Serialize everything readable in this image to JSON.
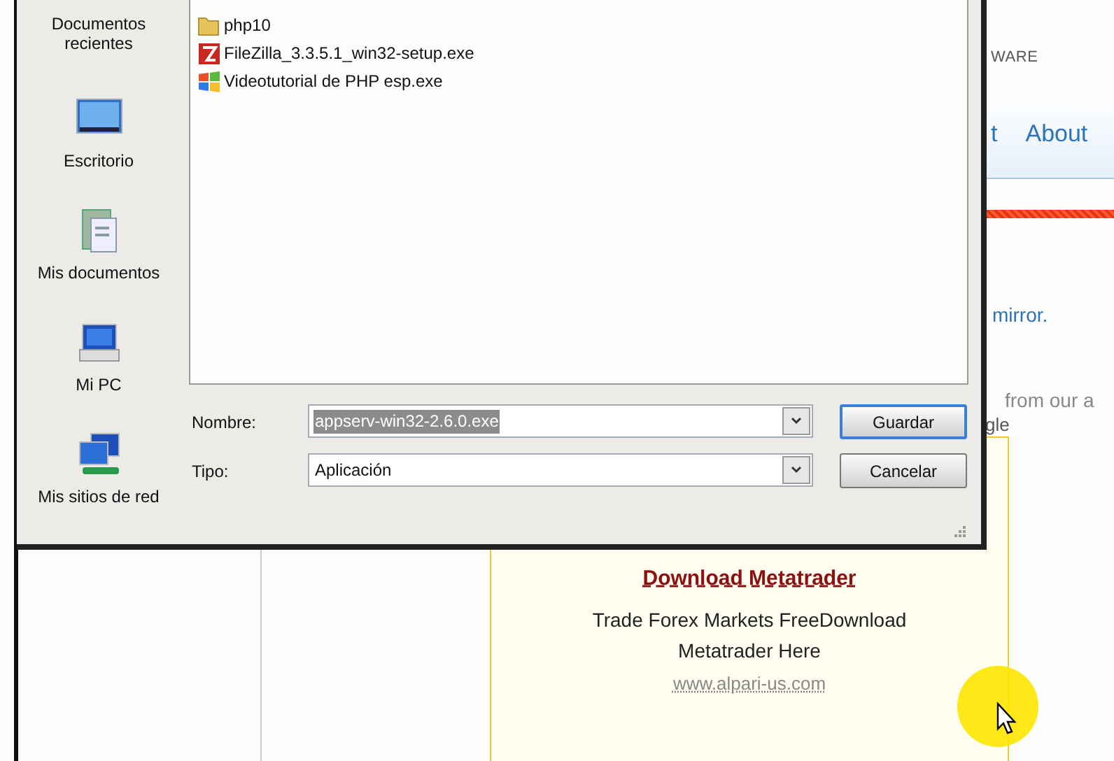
{
  "dialog": {
    "places": [
      {
        "label": "Documentos recientes",
        "kind": "recent"
      },
      {
        "label": "Escritorio",
        "kind": "desktop"
      },
      {
        "label": "Mis documentos",
        "kind": "documents"
      },
      {
        "label": "Mi PC",
        "kind": "computer"
      },
      {
        "label": "Mis sitios de red",
        "kind": "network"
      }
    ],
    "files": [
      {
        "name": "php10",
        "kind": "folder"
      },
      {
        "name": "FileZilla_3.3.5.1_win32-setup.exe",
        "kind": "filezilla"
      },
      {
        "name": "Videotutorial de PHP esp.exe",
        "kind": "installer"
      }
    ],
    "filename_label": "Nombre:",
    "filename_value": "appserv-win32-2.6.0.exe",
    "filename_selected": true,
    "type_label": "Tipo:",
    "type_value": "Aplicación",
    "buttons": [
      {
        "label": "Guardar",
        "default": true
      },
      {
        "label": "Cancelar",
        "default": false
      }
    ]
  },
  "webpage": {
    "brand_fragment": "WARE",
    "nav": [
      "t",
      "About"
    ],
    "mirror_link": "mirror.",
    "text_fragment": "from our a",
    "text_fragment_2": "gle",
    "ad": {
      "title": "Download Metatrader",
      "body": "Trade Forex Markets FreeDownload Metatrader Here",
      "url": "www.alpari-us.com"
    }
  }
}
